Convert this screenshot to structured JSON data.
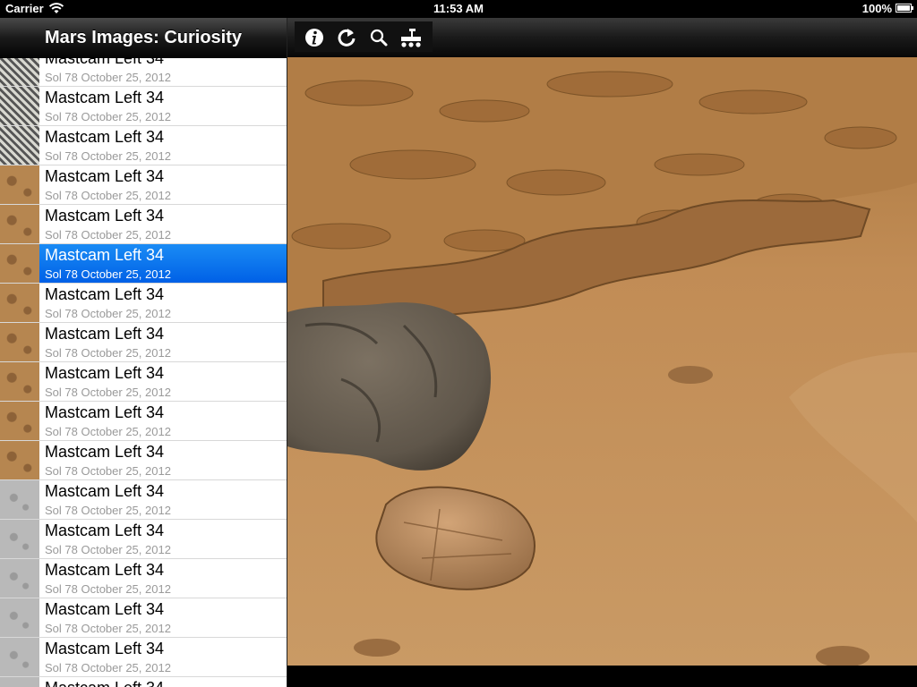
{
  "status_bar": {
    "carrier": "Carrier",
    "time": "11:53 AM",
    "battery": "100%"
  },
  "master": {
    "title": "Mars Images: Curiosity",
    "rows": [
      {
        "label": "Mastcam Left 34",
        "detail": "Sol 78  October 25, 2012",
        "thumb": "calibration-target",
        "selected": false
      },
      {
        "label": "Mastcam Left 34",
        "detail": "Sol 78  October 25, 2012",
        "thumb": "calibration-target",
        "selected": false
      },
      {
        "label": "Mastcam Left 34",
        "detail": "Sol 78  October 25, 2012",
        "thumb": "calibration-target",
        "selected": false
      },
      {
        "label": "Mastcam Left 34",
        "detail": "Sol 78  October 25, 2012",
        "thumb": "terrain",
        "selected": false
      },
      {
        "label": "Mastcam Left 34",
        "detail": "Sol 78  October 25, 2012",
        "thumb": "terrain",
        "selected": false
      },
      {
        "label": "Mastcam Left 34",
        "detail": "Sol 78  October 25, 2012",
        "thumb": "terrain",
        "selected": true
      },
      {
        "label": "Mastcam Left 34",
        "detail": "Sol 78  October 25, 2012",
        "thumb": "terrain",
        "selected": false
      },
      {
        "label": "Mastcam Left 34",
        "detail": "Sol 78  October 25, 2012",
        "thumb": "terrain",
        "selected": false
      },
      {
        "label": "Mastcam Left 34",
        "detail": "Sol 78  October 25, 2012",
        "thumb": "terrain",
        "selected": false
      },
      {
        "label": "Mastcam Left 34",
        "detail": "Sol 78  October 25, 2012",
        "thumb": "terrain",
        "selected": false
      },
      {
        "label": "Mastcam Left 34",
        "detail": "Sol 78  October 25, 2012",
        "thumb": "terrain",
        "selected": false
      },
      {
        "label": "Mastcam Left 34",
        "detail": "Sol 78  October 25, 2012",
        "thumb": "gray-terrain",
        "selected": false
      },
      {
        "label": "Mastcam Left 34",
        "detail": "Sol 78  October 25, 2012",
        "thumb": "gray-terrain",
        "selected": false
      },
      {
        "label": "Mastcam Left 34",
        "detail": "Sol 78  October 25, 2012",
        "thumb": "gray-terrain",
        "selected": false
      },
      {
        "label": "Mastcam Left 34",
        "detail": "Sol 78  October 25, 2012",
        "thumb": "gray-terrain",
        "selected": false
      },
      {
        "label": "Mastcam Left 34",
        "detail": "Sol 78  October 25, 2012",
        "thumb": "gray-terrain",
        "selected": false
      },
      {
        "label": "Mastcam Left 34",
        "detail": "Sol 78  October 25, 2012",
        "thumb": "gray-terrain",
        "selected": false
      }
    ]
  },
  "toolbar": {
    "buttons": [
      {
        "icon": "info-icon"
      },
      {
        "icon": "refresh-icon"
      },
      {
        "icon": "search-icon"
      },
      {
        "icon": "rover-icon"
      }
    ]
  },
  "colors": {
    "selection": "#1a8cf5",
    "mars_sand": "#c9955a",
    "rock_gray": "#6f6558"
  }
}
